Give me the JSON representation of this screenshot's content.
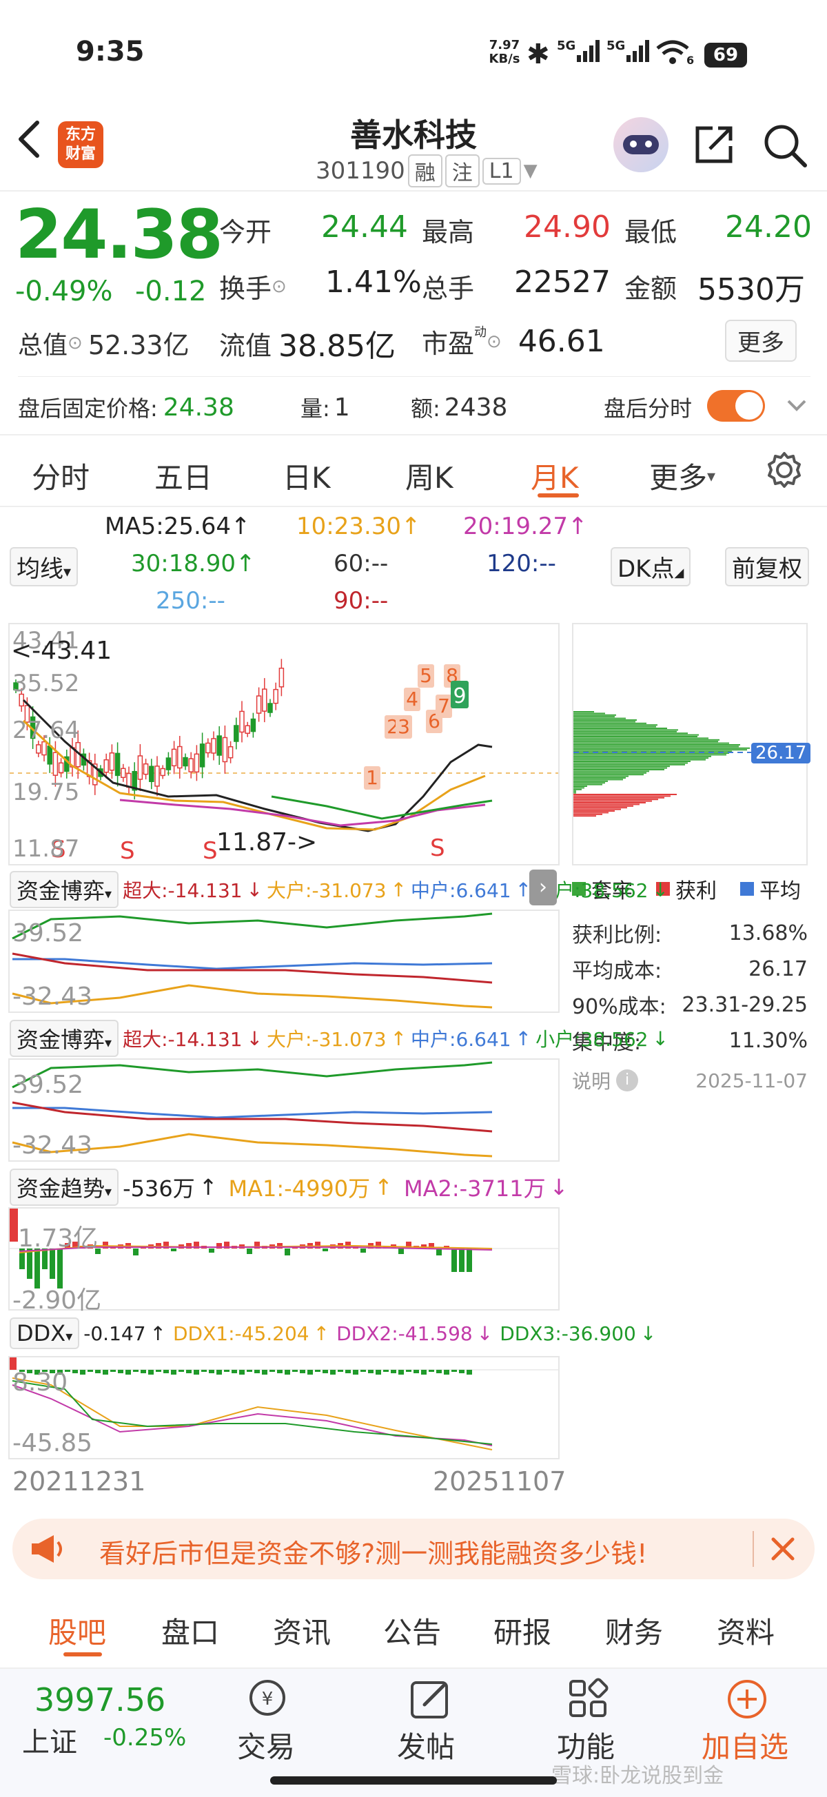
{
  "status": {
    "time": "9:35",
    "net_speed_top": "7.97",
    "net_speed_bottom": "KB/s",
    "sig1": "5G",
    "sig2": "5G",
    "wifi_sub": "6",
    "battery": "69"
  },
  "header": {
    "title": "善水科技",
    "code": "301190",
    "tag1": "融",
    "tag2": "注",
    "tag3": "L1",
    "logo_line1": "东方",
    "logo_line2": "财富"
  },
  "quote": {
    "price": "24.38",
    "change_pct": "-0.49%",
    "change": "-0.12",
    "open_label": "今开",
    "open": "24.44",
    "high_label": "最高",
    "high": "24.90",
    "low_label": "最低",
    "low": "24.20",
    "turnover_label": "换手",
    "turnover": "1.41%",
    "volume_label": "总手",
    "volume": "22527",
    "amount_label": "金额",
    "amount": "5530万",
    "mktcap_label": "总值",
    "mktcap": "52.33亿",
    "float_label": "流值",
    "float": "38.85亿",
    "pe_label": "市盈",
    "pe_sup": "动",
    "pe": "46.61",
    "more": "更多"
  },
  "after_hours": {
    "price_label": "盘后固定价格:",
    "price": "24.38",
    "vol_label": "量:",
    "vol": "1",
    "amt_label": "额:",
    "amt": "2438",
    "toggle_label": "盘后分时"
  },
  "chart_tabs": [
    "分时",
    "五日",
    "日K",
    "周K",
    "月K",
    "更多"
  ],
  "ma": {
    "ma5": "MA5:25.64",
    "ma10": "10:23.30",
    "ma20": "20:19.27",
    "ma30": "30:18.90",
    "ma60": "60:--",
    "ma120": "120:--",
    "ma250": "250:--",
    "ma90": "90:--",
    "selector": "均线",
    "dk": "DK点",
    "fq": "前复权"
  },
  "kline": {
    "y_top": "43.41",
    "y_2": "35.52",
    "y_3": "27.64",
    "y_4": "19.75",
    "y_bottom": "11.87",
    "max_note": "<-43.41",
    "min_note": "11.87->",
    "date_start": "20211231",
    "date_end": "20251107",
    "markers": [
      "1",
      "2",
      "3",
      "4",
      "5",
      "6",
      "7",
      "8",
      "9"
    ],
    "sig": "S"
  },
  "chip_dist": {
    "avg_label": "26.17",
    "legend_trap": "套牢",
    "legend_profit": "获利",
    "legend_avg": "平均",
    "rows": [
      {
        "k": "获利比例:",
        "v": "13.68%"
      },
      {
        "k": "平均成本:",
        "v": "26.17"
      },
      {
        "k": "90%成本:",
        "v": "23.31-29.25"
      },
      {
        "k": "集中度:",
        "v": "11.30%"
      }
    ],
    "note_label": "说明",
    "date": "2025-11-07"
  },
  "fund_game": {
    "selector": "资金博弈",
    "big": "超大:-14.131",
    "large": "大户:-31.073",
    "mid": "中户:6.641",
    "small": "小户:38.562",
    "y_top": "39.52",
    "y_bottom": "-32.43"
  },
  "fund_trend": {
    "selector": "资金趋势",
    "val": "-536万",
    "ma1": "MA1:-4990万",
    "ma2": "MA2:-3711万",
    "y_top": "1.73亿",
    "y_bottom": "-2.90亿"
  },
  "ddx": {
    "selector": "DDX",
    "val": "-0.147",
    "ddx1": "DDX1:-45.204",
    "ddx2": "DDX2:-41.598",
    "ddx3": "DDX3:-36.900",
    "y_top": "8.30",
    "y_bottom": "-45.85"
  },
  "banner": {
    "text": "看好后市但是资金不够?测一测我能融资多少钱!"
  },
  "bottom_tabs": [
    "股吧",
    "盘口",
    "资讯",
    "公告",
    "研报",
    "财务",
    "资料"
  ],
  "bottom_bar": {
    "index_value": "3997.56",
    "index_name": "上证",
    "index_change": "-0.25%",
    "trade": "交易",
    "post": "发帖",
    "func": "功能",
    "add": "加自选",
    "watermark": "雪球:卧龙说股到金"
  }
}
